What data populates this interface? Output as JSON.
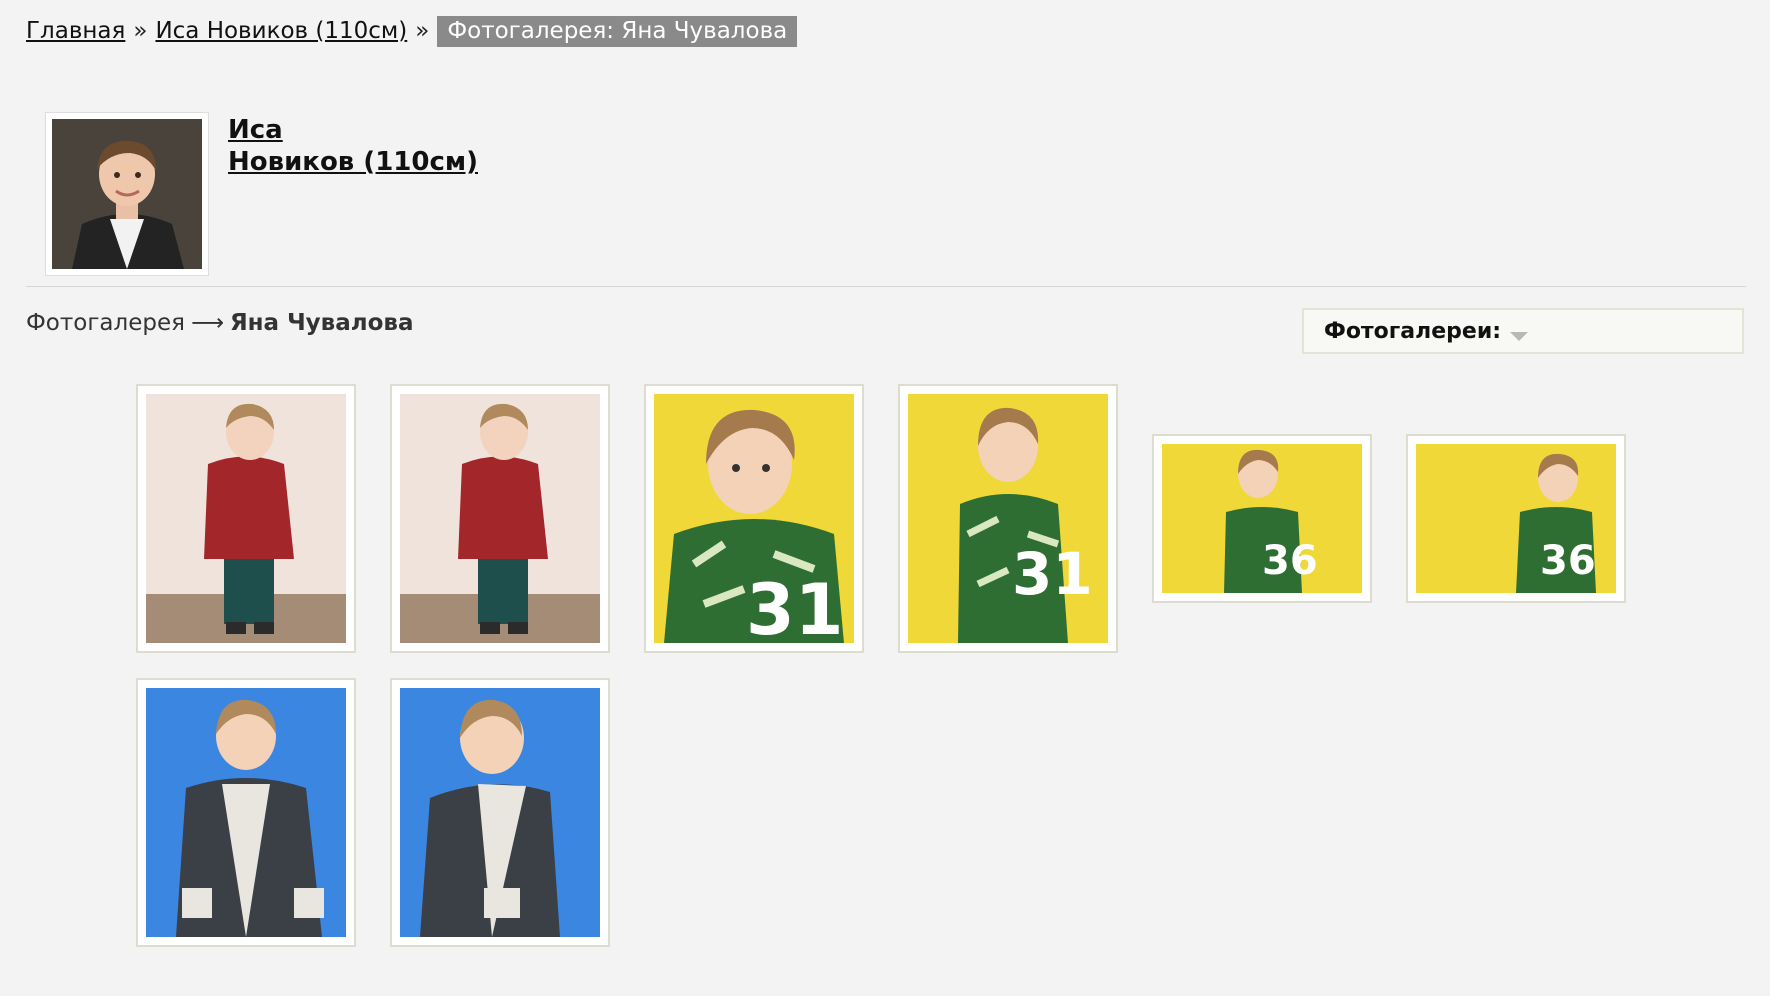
{
  "breadcrumb": {
    "home": "Главная",
    "separator": "»",
    "model": "Иса Новиков (110см)",
    "current": "Фотогалерея: Яна Чувалова"
  },
  "profile": {
    "first_name": "Иса",
    "last_name": "Новиков (110см)"
  },
  "gallery": {
    "section": "Фотогалерея",
    "arrow": "⟶",
    "author": "Яна Чувалова"
  },
  "dropdown": {
    "label": "Фотогалереи:"
  },
  "photos": [
    {
      "background": "#efe3dc",
      "subject": "child-red-sweater-icon"
    },
    {
      "background": "#efe3dc",
      "subject": "child-red-sweater-icon"
    },
    {
      "background": "#f0d838",
      "subject": "child-green-sweater-icon"
    },
    {
      "background": "#f0d838",
      "subject": "child-green-sweater-icon"
    },
    {
      "background": "#f0d838",
      "subject": "child-green-sweater-icon"
    },
    {
      "background": "#f0d838",
      "subject": "child-green-sweater-icon"
    },
    {
      "background": "#3a86e0",
      "subject": "child-coat-icon"
    },
    {
      "background": "#3a86e0",
      "subject": "child-coat-icon"
    }
  ],
  "colors": {
    "page_bg": "#f3f3f3",
    "breadcrumb_current_bg": "#8a8a8a",
    "thumb_border": "#dcdcd0"
  }
}
